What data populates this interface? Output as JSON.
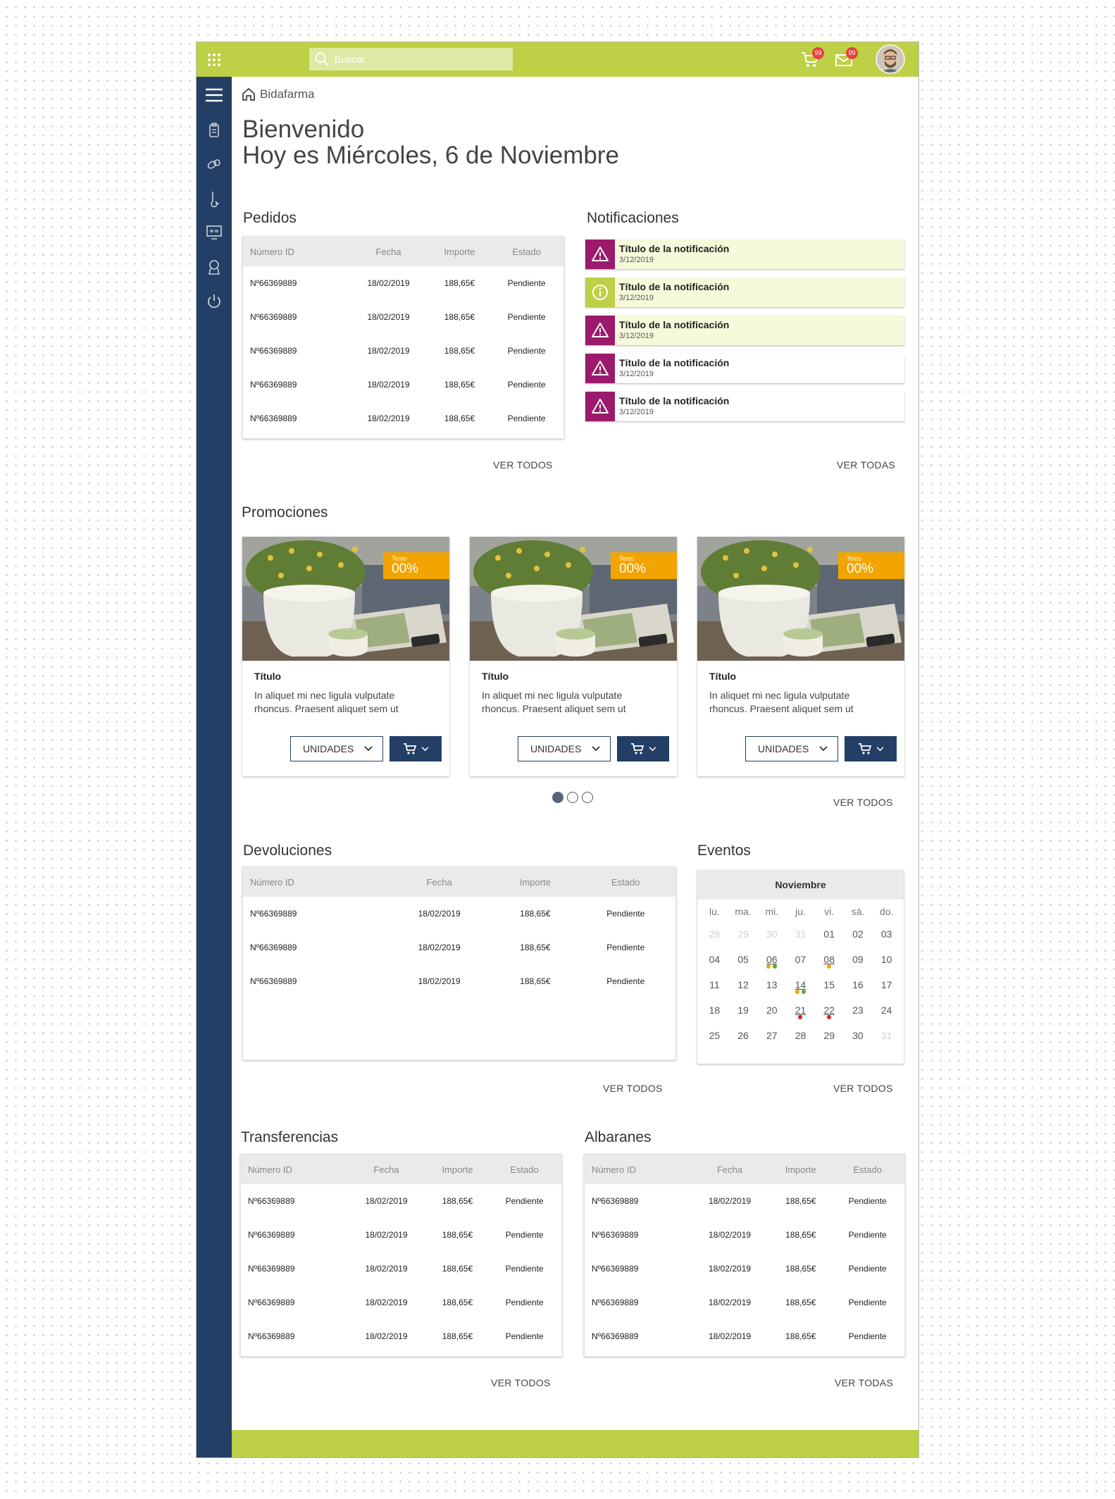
{
  "topbar": {
    "search_placeholder": "Buscar...",
    "cart_badge": "99",
    "mail_badge": "99",
    "brand_color": "#bdd046"
  },
  "breadcrumb": {
    "label": "Bidafarma"
  },
  "welcome": {
    "line1": "Bienvenido",
    "line2": "Hoy es Miércoles, 6 de Noviembre"
  },
  "pedidos": {
    "title": "Pedidos",
    "columns": [
      "Número ID",
      "Fecha",
      "Importe",
      "Estado"
    ],
    "rows": [
      [
        "Nº66369889",
        "18/02/2019",
        "188,65€",
        "Pendiente"
      ],
      [
        "Nº66369889",
        "18/02/2019",
        "188,65€",
        "Pendiente"
      ],
      [
        "Nº66369889",
        "18/02/2019",
        "188,65€",
        "Pendiente"
      ],
      [
        "Nº66369889",
        "18/02/2019",
        "188,65€",
        "Pendiente"
      ],
      [
        "Nº66369889",
        "18/02/2019",
        "188,65€",
        "Pendiente"
      ]
    ],
    "more": "VER TODOS"
  },
  "notificaciones": {
    "title": "Notificaciones",
    "items": [
      {
        "title": "Título de la notificación",
        "date": "3/12/2019",
        "icon": "warning-icon"
      },
      {
        "title": "Título de la notificación",
        "date": "3/12/2019",
        "icon": "info-icon"
      },
      {
        "title": "Título de la notificación",
        "date": "3/12/2019",
        "icon": "warning-icon"
      },
      {
        "title": "Título de la notificación",
        "date": "3/12/2019",
        "icon": "warning-icon"
      },
      {
        "title": "Título de la notificación",
        "date": "3/12/2019",
        "icon": "warning-icon"
      }
    ],
    "more": "VER TODAS"
  },
  "promociones": {
    "title": "Promociones",
    "cards": [
      {
        "tag_small": "Texto",
        "tag_percent": "00%",
        "title": "Título",
        "desc": "In aliquet mi nec ligula vulputate rhoncus. Praesent aliquet sem ut",
        "units": "UNIDADES"
      },
      {
        "tag_small": "Texto",
        "tag_percent": "00%",
        "title": "Título",
        "desc": "In aliquet mi nec ligula vulputate rhoncus. Praesent aliquet sem ut",
        "units": "UNIDADES"
      },
      {
        "tag_small": "Texto",
        "tag_percent": "00%",
        "title": "Título",
        "desc": "In aliquet mi nec ligula vulputate rhoncus. Praesent aliquet sem ut",
        "units": "UNIDADES"
      }
    ],
    "more": "VER TODOS",
    "active_page": 1,
    "page_count": 3
  },
  "devoluciones": {
    "title": "Devoluciones",
    "columns": [
      "Número ID",
      "Fecha",
      "Importe",
      "Estado"
    ],
    "rows": [
      [
        "Nº66369889",
        "18/02/2019",
        "188,65€",
        "Pendiente"
      ],
      [
        "Nº66369889",
        "18/02/2019",
        "188,65€",
        "Pendiente"
      ],
      [
        "Nº66369889",
        "18/02/2019",
        "188,65€",
        "Pendiente"
      ]
    ],
    "more": "VER TODOS"
  },
  "eventos": {
    "title": "Eventos",
    "month": "Noviembre",
    "weekdays": [
      "lu.",
      "ma.",
      "mi.",
      "ju.",
      "vi.",
      "sá.",
      "do."
    ],
    "days": [
      [
        "28",
        "29",
        "30",
        "31",
        "01",
        "02",
        "03"
      ],
      [
        "04",
        "05",
        "06",
        "07",
        "08",
        "09",
        "10"
      ],
      [
        "11",
        "12",
        "13",
        "14",
        "15",
        "16",
        "17"
      ],
      [
        "18",
        "19",
        "20",
        "21",
        "22",
        "23",
        "24"
      ],
      [
        "25",
        "26",
        "27",
        "28",
        "29",
        "30",
        "31"
      ]
    ],
    "more": "VER TODOS",
    "event_colors": {
      "orange": "#f2a400",
      "green": "#5aa832",
      "red": "#e0211d"
    }
  },
  "transferencias": {
    "title": "Transferencias",
    "columns": [
      "Número ID",
      "Fecha",
      "Importe",
      "Estado"
    ],
    "rows": [
      [
        "Nº66369889",
        "18/02/2019",
        "188,65€",
        "Pendiente"
      ],
      [
        "Nº66369889",
        "18/02/2019",
        "188,65€",
        "Pendiente"
      ],
      [
        "Nº66369889",
        "18/02/2019",
        "188,65€",
        "Pendiente"
      ],
      [
        "Nº66369889",
        "18/02/2019",
        "188,65€",
        "Pendiente"
      ],
      [
        "Nº66369889",
        "18/02/2019",
        "188,65€",
        "Pendiente"
      ]
    ],
    "more": "VER TODOS"
  },
  "albaranes": {
    "title": "Albaranes",
    "columns": [
      "Número ID",
      "Fecha",
      "Importe",
      "Estado"
    ],
    "rows": [
      [
        "Nº66369889",
        "18/02/2019",
        "188,65€",
        "Pendiente"
      ],
      [
        "Nº66369889",
        "18/02/2019",
        "188,65€",
        "Pendiente"
      ],
      [
        "Nº66369889",
        "18/02/2019",
        "188,65€",
        "Pendiente"
      ],
      [
        "Nº66369889",
        "18/02/2019",
        "188,65€",
        "Pendiente"
      ],
      [
        "Nº66369889",
        "18/02/2019",
        "188,65€",
        "Pendiente"
      ]
    ],
    "more": "VER TODAS"
  },
  "colors": {
    "navy": "#233f66",
    "green": "#bdd046",
    "notif_purple": "#9b1a6c",
    "notif_highlight": "#f6f9da",
    "promo_orange": "#f2a400"
  }
}
